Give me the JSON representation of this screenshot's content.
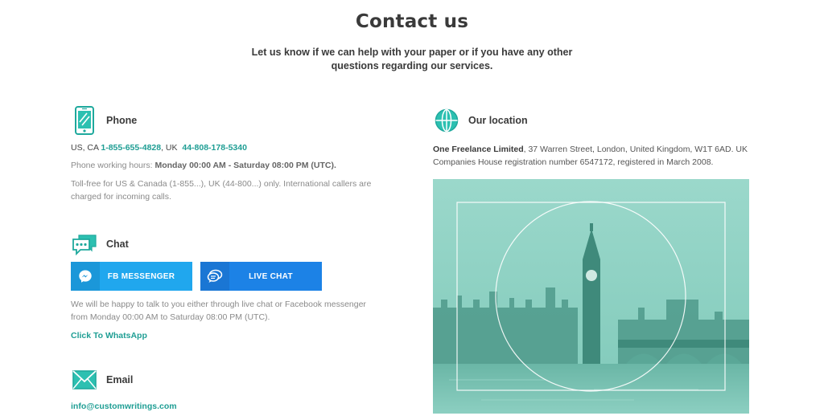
{
  "page": {
    "title": "Contact us",
    "subtitle": "Let us know if we can help with your paper or if you have any other questions regarding our services."
  },
  "phone": {
    "heading": "Phone",
    "prefix_us": "US, CA",
    "us_number": "1-855-655-4828",
    "separator": ", UK",
    "uk_number": "44-808-178-5340",
    "hours_label": "Phone working hours:",
    "hours_value": "Monday 00:00 AM - Saturday 08:00 PM (UTC).",
    "tollfree_note": "Toll-free for US & Canada (1-855...), UK (44-800...) only. International callers are charged for incoming calls.",
    "icon": "smartphone-icon"
  },
  "chat": {
    "heading": "Chat",
    "icon": "chat-bubbles-icon",
    "fb_button": "FB MESSENGER",
    "live_button": "LIVE CHAT",
    "description": "We will be happy to talk to you either through live chat or Facebook messenger from Monday 00:00 AM to Saturday 08:00 PM (UTC).",
    "whatsapp_link": "Click To WhatsApp"
  },
  "email": {
    "heading": "Email",
    "icon": "envelope-icon",
    "address": "info@customwritings.com"
  },
  "location": {
    "heading": "Our location",
    "icon": "globe-icon",
    "company": "One Freelance Limited",
    "address_text": ", 37 Warren Street, London, United Kingdom, W1T 6AD. UK Companies House registration number 6547172, registered in March 2008."
  },
  "colors": {
    "accent_teal": "#1f9e94",
    "fb_blue": "#20a7ee",
    "live_blue": "#1c82e6"
  }
}
